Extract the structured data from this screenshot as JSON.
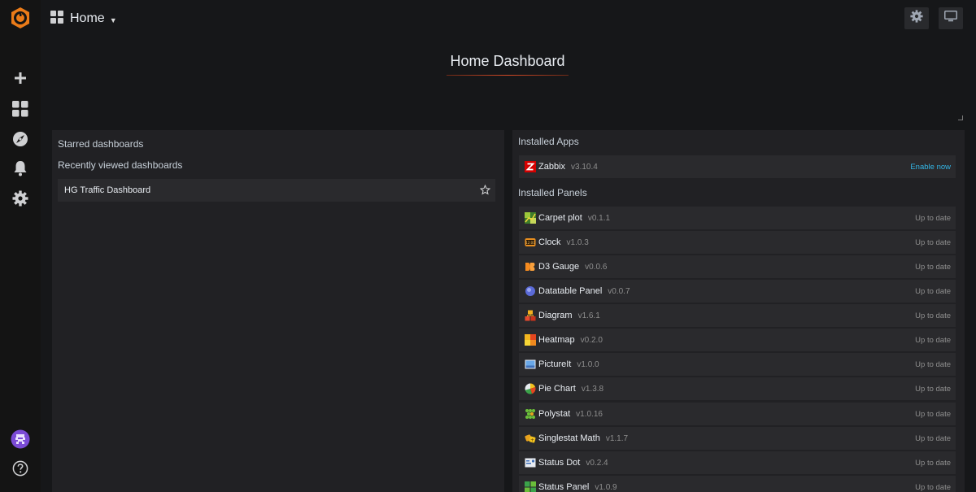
{
  "nav": {
    "title": "Home"
  },
  "header": {
    "title": "Home Dashboard"
  },
  "dashboards": {
    "starred_label": "Starred dashboards",
    "recent_label": "Recently viewed dashboards",
    "recent": [
      {
        "name": "HG Traffic Dashboard"
      }
    ]
  },
  "plugins": {
    "apps_label": "Installed Apps",
    "panels_label": "Installed Panels",
    "apps": [
      {
        "name": "Zabbix",
        "version": "v3.10.4",
        "status": "Enable now",
        "icon": "zabbix-icon"
      }
    ],
    "panels": [
      {
        "name": "Carpet plot",
        "version": "v0.1.1",
        "status": "Up to date",
        "icon": "carpet-plot-icon"
      },
      {
        "name": "Clock",
        "version": "v1.0.3",
        "status": "Up to date",
        "icon": "clock-icon"
      },
      {
        "name": "D3 Gauge",
        "version": "v0.0.6",
        "status": "Up to date",
        "icon": "d3-gauge-icon"
      },
      {
        "name": "Datatable Panel",
        "version": "v0.0.7",
        "status": "Up to date",
        "icon": "datatable-icon"
      },
      {
        "name": "Diagram",
        "version": "v1.6.1",
        "status": "Up to date",
        "icon": "diagram-icon"
      },
      {
        "name": "Heatmap",
        "version": "v0.2.0",
        "status": "Up to date",
        "icon": "heatmap-icon"
      },
      {
        "name": "PictureIt",
        "version": "v1.0.0",
        "status": "Up to date",
        "icon": "pictureit-icon"
      },
      {
        "name": "Pie Chart",
        "version": "v1.3.8",
        "status": "Up to date",
        "icon": "pie-chart-icon"
      },
      {
        "name": "Polystat",
        "version": "v1.0.16",
        "status": "Up to date",
        "icon": "polystat-icon"
      },
      {
        "name": "Singlestat Math",
        "version": "v1.1.7",
        "status": "Up to date",
        "icon": "singlestat-math-icon"
      },
      {
        "name": "Status Dot",
        "version": "v0.2.4",
        "status": "Up to date",
        "icon": "status-dot-icon"
      },
      {
        "name": "Status Panel",
        "version": "v1.0.9",
        "status": "Up to date",
        "icon": "status-panel-icon"
      }
    ]
  },
  "colors": {
    "accent": "#eb7b18",
    "link": "#33b5e5",
    "background": "#161719",
    "panel": "#212124"
  }
}
